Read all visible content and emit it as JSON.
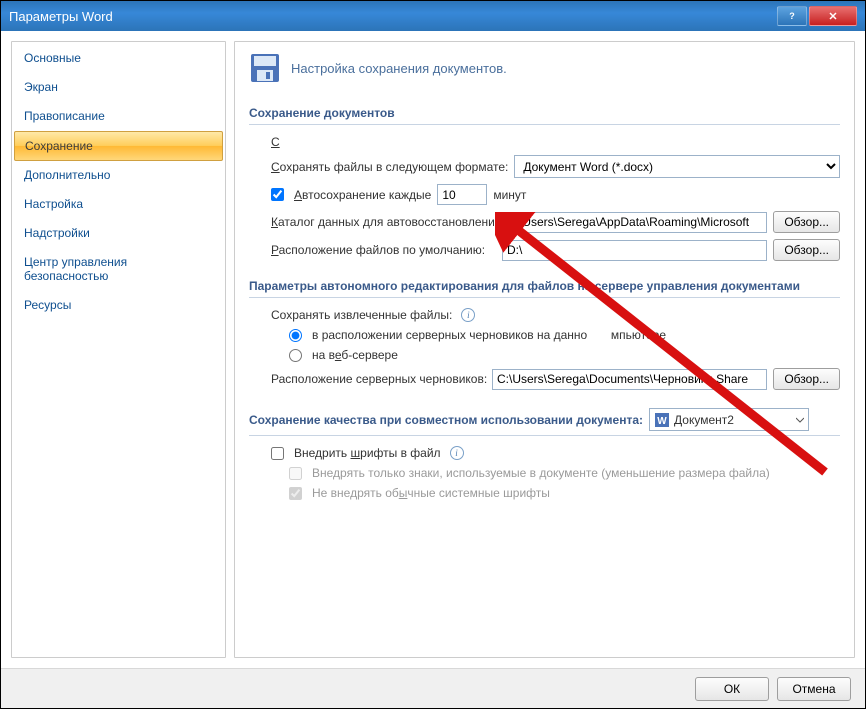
{
  "window": {
    "title": "Параметры Word"
  },
  "sidebar": {
    "items": [
      "Основные",
      "Экран",
      "Правописание",
      "Сохранение",
      "Дополнительно",
      "Настройка",
      "Надстройки",
      "Центр управления безопасностью",
      "Ресурсы"
    ],
    "selected_index": 3
  },
  "header": {
    "text": "Настройка сохранения документов."
  },
  "section1": {
    "title": "Сохранение документов",
    "save_format_label": "Сохранять файлы в следующем формате:",
    "save_format_value": "Документ Word (*.docx)",
    "autosave_label": "Автосохранение каждые",
    "autosave_value": "10",
    "autosave_unit": "минут",
    "autorecover_label": "Каталог данных для автовосстановления:",
    "autorecover_path": "C:\\Users\\Serega\\AppData\\Roaming\\Microsoft",
    "default_loc_label": "Расположение файлов по умолчанию:",
    "default_loc_path": "D:\\",
    "browse_label": "Обзор..."
  },
  "section2": {
    "title": "Параметры автономного редактирования для файлов на сервере управления документами",
    "keep_extracted_label": "Сохранять извлеченные файлы:",
    "opt_local": "в расположении серверных черновиков на данном компьютере",
    "opt_web": "на веб-сервере",
    "drafts_loc_label": "Расположение серверных черновиков:",
    "drafts_loc_path": "C:\\Users\\Serega\\Documents\\Черновики Share",
    "browse_label": "Обзор..."
  },
  "section3": {
    "title": "Сохранение качества при совместном использовании документа:",
    "doc_name": "Документ2",
    "embed_fonts": "Внедрить шрифты в файл",
    "embed_only_used": "Внедрять только знаки, используемые в документе (уменьшение размера файла)",
    "dont_embed_system": "Не внедрять обычные системные шрифты"
  },
  "footer": {
    "ok": "ОК",
    "cancel": "Отмена"
  }
}
